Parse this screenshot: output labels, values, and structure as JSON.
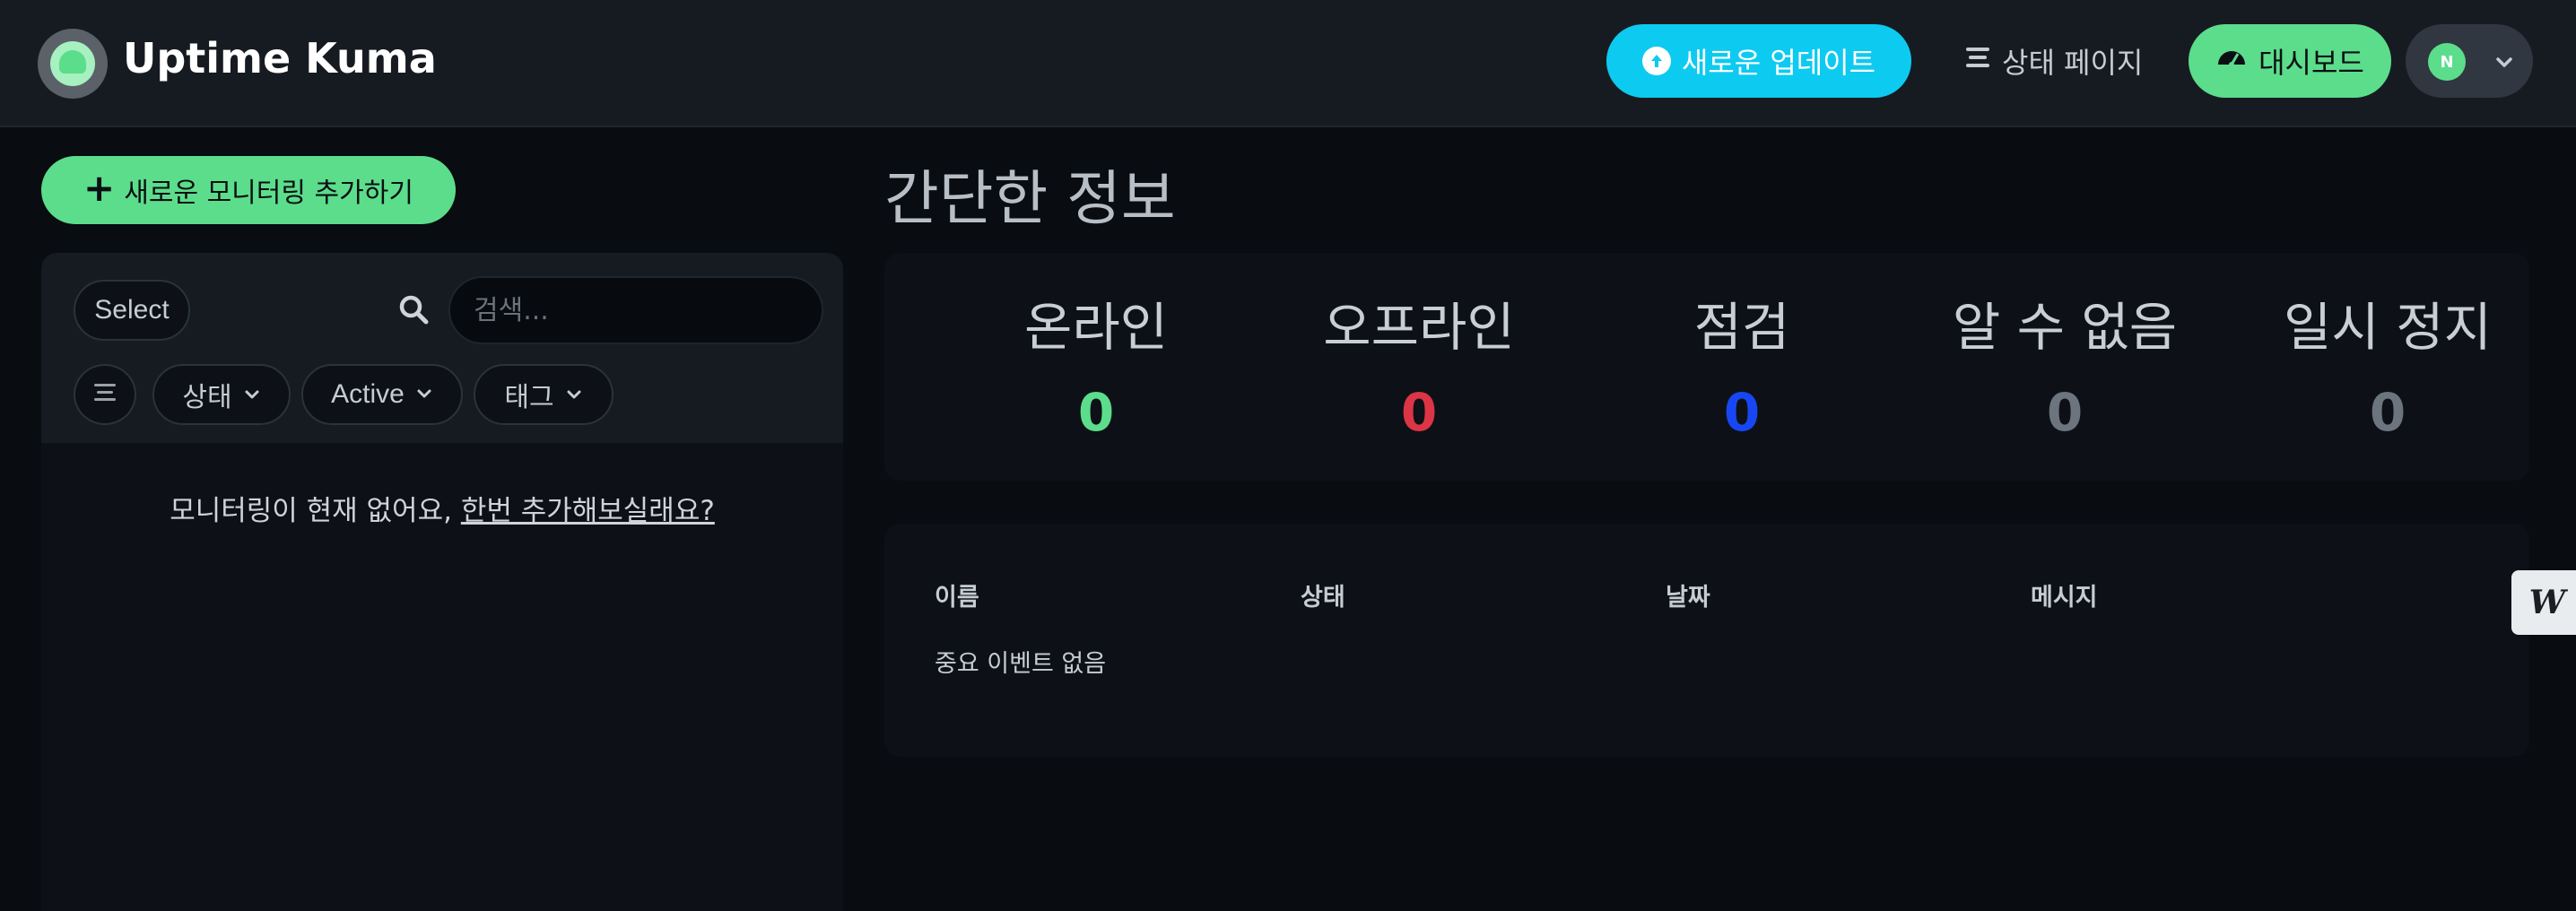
{
  "header": {
    "app_title": "Uptime Kuma",
    "update_button": "새로운 업데이트",
    "status_page_link": "상태 페이지",
    "dashboard_button": "대시보드",
    "avatar_initial": "N"
  },
  "sidebar": {
    "add_monitor_button": "새로운 모니터링 추가하기",
    "select_button": "Select",
    "search_placeholder": "검색...",
    "filters": {
      "status": "상태",
      "active": "Active",
      "tags": "태그"
    },
    "empty_message": "모니터링이 현재 없어요,",
    "empty_link": "한번 추가해보실래요?"
  },
  "main": {
    "title": "간단한 정보",
    "stats": [
      {
        "label": "온라인",
        "value": "0",
        "color": "#5cdd8b"
      },
      {
        "label": "오프라인",
        "value": "0",
        "color": "#dc3545"
      },
      {
        "label": "점검",
        "value": "0",
        "color": "#1747f5"
      },
      {
        "label": "알 수 없음",
        "value": "0",
        "color": "#6c757d"
      },
      {
        "label": "일시 정지",
        "value": "0",
        "color": "#6c757d"
      }
    ],
    "events_table": {
      "columns": [
        "이름",
        "상태",
        "날짜",
        "메시지"
      ],
      "empty_text": "중요 이벤트 없음"
    }
  },
  "side_tab": {
    "label": "W"
  },
  "colors": {
    "accent": "#5cdd8b",
    "info": "#0dcaf0",
    "header_bg": "#161b22",
    "page_bg": "#090c10"
  }
}
